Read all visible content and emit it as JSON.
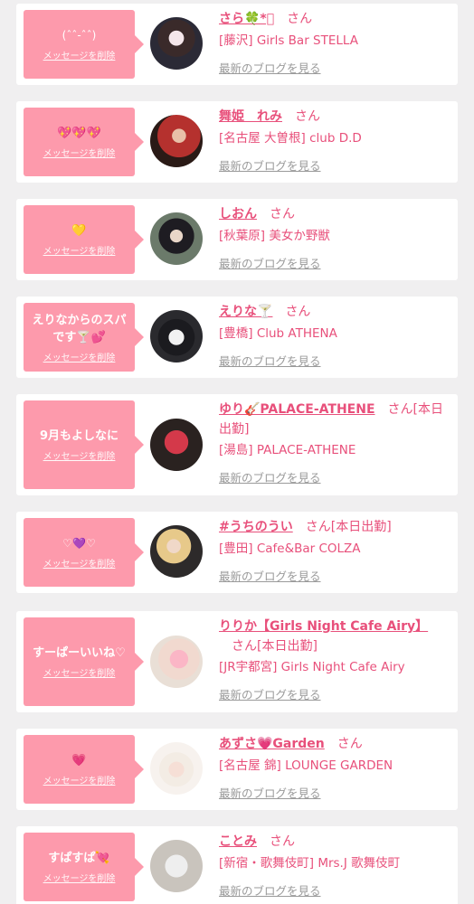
{
  "delete_label": "メッセージを削除",
  "blog_label": "最新のブログを見る",
  "san_label": "さん",
  "colors": {
    "accent": "#e8507b",
    "bubble": "#fd9aac",
    "background": "#f0eff0"
  },
  "items": [
    {
      "message": "(ˆˆ-ˆˆ)",
      "name": "さら🍀*ﾟ",
      "suffix": "",
      "shop": "[藤沢] Girls Bar STELLA"
    },
    {
      "message": "💖💖💖",
      "name": "舞姫　れみ",
      "suffix": "",
      "shop": "[名古屋 大曽根] club D.D"
    },
    {
      "message": "💛",
      "name": "しおん",
      "suffix": "",
      "shop": "[秋葉原] 美女か野獣"
    },
    {
      "message": "えりなからのスパです🍸💕",
      "name": "えりな🍸",
      "suffix": "",
      "shop": "[豊橋] Club ATHENA"
    },
    {
      "message": "9月もよしなに",
      "name": "ゆり🎸PALACE-ATHENE",
      "suffix": "[本日出勤]",
      "shop": "[湯島] PALACE-ATHENE"
    },
    {
      "message": "♡💜♡",
      "name": "#うちのうい",
      "suffix": "[本日出勤]",
      "shop": "[豊田] Cafe&Bar COLZA"
    },
    {
      "message": "すーぱーいいね♡",
      "name": "りりか【Girls Night Cafe Airy】",
      "suffix": "[本日出勤]",
      "shop": "[JR宇都宮] Girls Night Cafe Airy"
    },
    {
      "message": "💗",
      "name": "あずさ💗Garden",
      "suffix": "",
      "shop": "[名古屋 錦] LOUNGE GARDEN"
    },
    {
      "message": "すぱすぱ💘",
      "name": "ことみ",
      "suffix": "",
      "shop": "[新宿・歌舞伎町] Mrs.J 歌舞伎町"
    }
  ]
}
